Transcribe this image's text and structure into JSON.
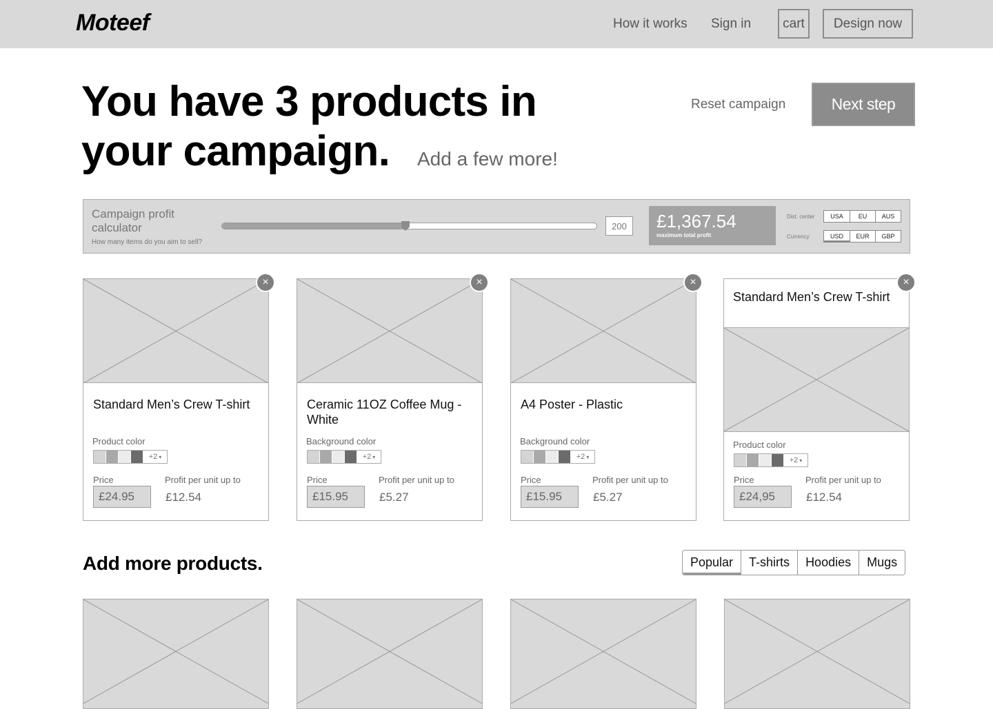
{
  "nav": {
    "logo": "Moteef",
    "how_it_works": "How it works",
    "sign_in": "Sign in",
    "cart": "cart",
    "design_now": "Design now"
  },
  "hero": {
    "title": "You have 3 products in your campaign.",
    "subtitle": "Add a few more!",
    "reset_label": "Reset campaign",
    "next_label": "Next step"
  },
  "calculator": {
    "title": "Campaign profit calculator",
    "hint": "How many items do you aim to sell?",
    "slider_fraction": 0.49,
    "quantity": "200",
    "profit_value": "£1,367.54",
    "profit_label": "maximum total profit",
    "dist_label": "Dist. center",
    "dist_options": [
      "USA",
      "EU",
      "AUS"
    ],
    "dist_selected": "USA",
    "currency_label": "Currency",
    "currency_options": [
      "USD",
      "EUR",
      "GBP"
    ],
    "currency_selected": "USD"
  },
  "colors": {
    "swatches": [
      "#d4d4d4",
      "#a9a9a9",
      "#ececec",
      "#6b6b6b"
    ],
    "accent_gray": "#8c8c8c"
  },
  "products": [
    {
      "title": "Standard Men’s Crew T-shirt",
      "color_label": "Product color",
      "more_colors": "+2",
      "price_label": "Price",
      "price": "£24.95",
      "profit_label": "Profit per unit up to",
      "profit": "£12.54"
    },
    {
      "title": "Ceramic 11OZ Coffee Mug - White",
      "color_label": "Background color",
      "more_colors": "+2",
      "price_label": "Price",
      "price": "£15.95",
      "profit_label": "Profit per unit up to",
      "profit": "£5.27"
    },
    {
      "title": "A4 Poster - Plastic",
      "color_label": "Background color",
      "more_colors": "+2",
      "price_label": "Price",
      "price": "£15.95",
      "profit_label": "Profit per unit up to",
      "profit": "£5.27"
    },
    {
      "title": "Standard Men’s Crew T-shirt",
      "color_label": "Product color",
      "more_colors": "+2",
      "price_label": "Price",
      "price": "£24,95",
      "profit_label": "Profit per unit up to",
      "profit": "£12.54"
    }
  ],
  "more": {
    "title": "Add more products.",
    "tabs": [
      "Popular",
      "T-shirts",
      "Hoodies",
      "Mugs"
    ],
    "active_tab": "Popular"
  },
  "icons": {
    "close": "×",
    "caret": "▾"
  }
}
